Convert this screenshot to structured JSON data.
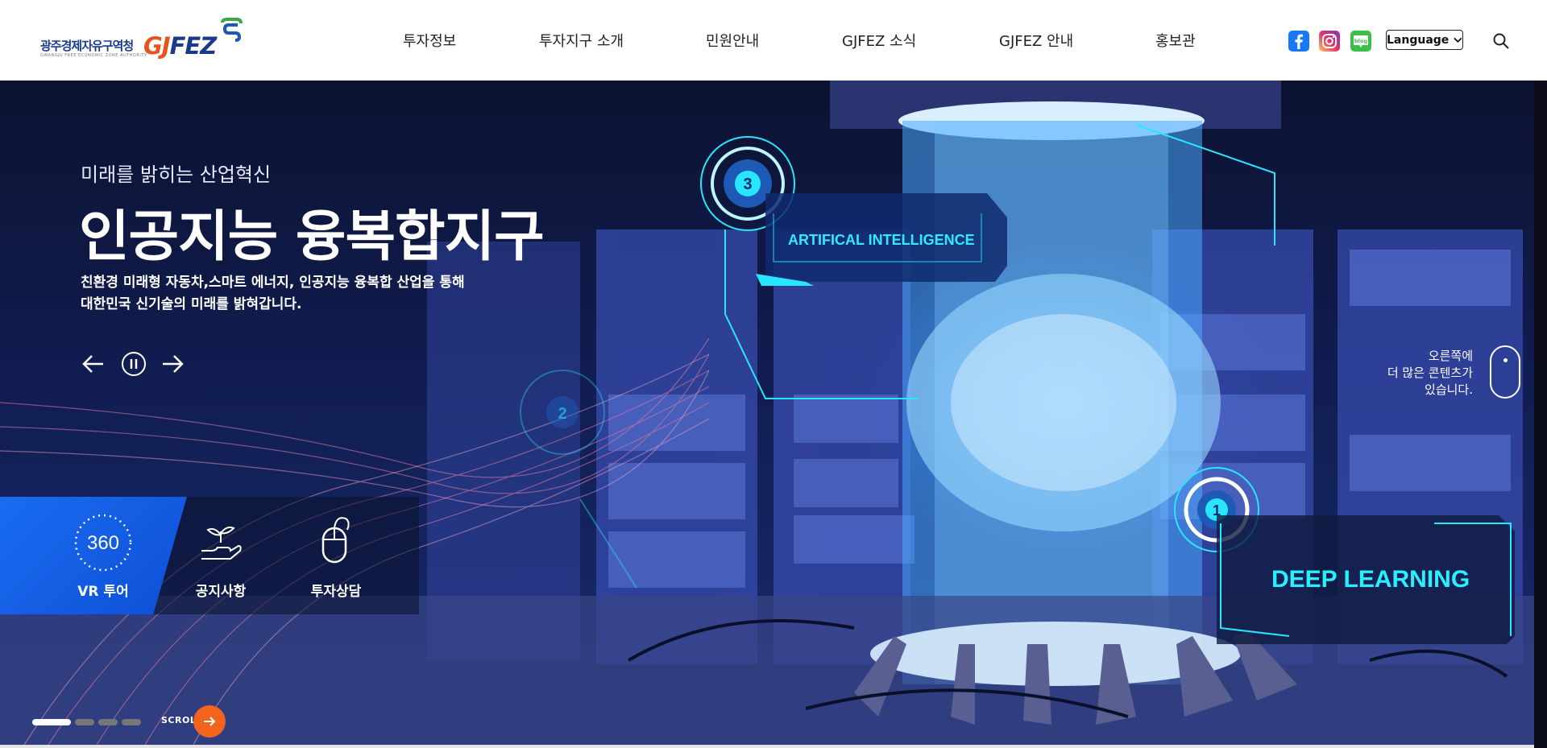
{
  "header": {
    "logo": {
      "korean": "광주경제자유구역청",
      "sub": "GWANGJU FREE ECONOMIC ZONE AUTHORITY",
      "brand_g": "GJ",
      "brand_rest": "FEZ"
    },
    "nav": [
      {
        "label": "투자정보"
      },
      {
        "label": "투자지구 소개"
      },
      {
        "label": "민원안내"
      },
      {
        "label": "GJFEZ 소식"
      },
      {
        "label": "GJFEZ 안내"
      },
      {
        "label": "홍보관"
      }
    ],
    "sns": [
      "facebook-icon",
      "instagram-icon",
      "blog-icon"
    ],
    "blog_label": "blog",
    "language_label": "Language"
  },
  "hero": {
    "tagline": "미래를 밝히는 산업혁신",
    "title": "인공지능 융복합지구",
    "desc_line1": "친환경 미래형 자동차,스마트 에너지, 인공지능 융복합 산업을 통해",
    "desc_line2": "대한민국 신기술의 미래를 밝혀갑니다.",
    "hud_ai": "ARTIFICAL INTELLIGENCE",
    "hud_dl": "DEEP LEARNING",
    "hud_nums": [
      "3",
      "2",
      "1"
    ],
    "scroll_msg": [
      "오른쪽에",
      "더 많은 콘텐츠가",
      "있습니다."
    ],
    "quick_menu": [
      {
        "label": "VR 투어",
        "icon_text": "360"
      },
      {
        "label": "공지사항"
      },
      {
        "label": "투자상담"
      }
    ],
    "slide_count": 4,
    "active_slide": 1,
    "scroll_label": "SCROLL"
  },
  "colors": {
    "accent": "#f0641d",
    "brand_blue": "#1a3a8c",
    "vr_blue": "#1a6cf0",
    "hud_cyan": "#28e6ff"
  }
}
